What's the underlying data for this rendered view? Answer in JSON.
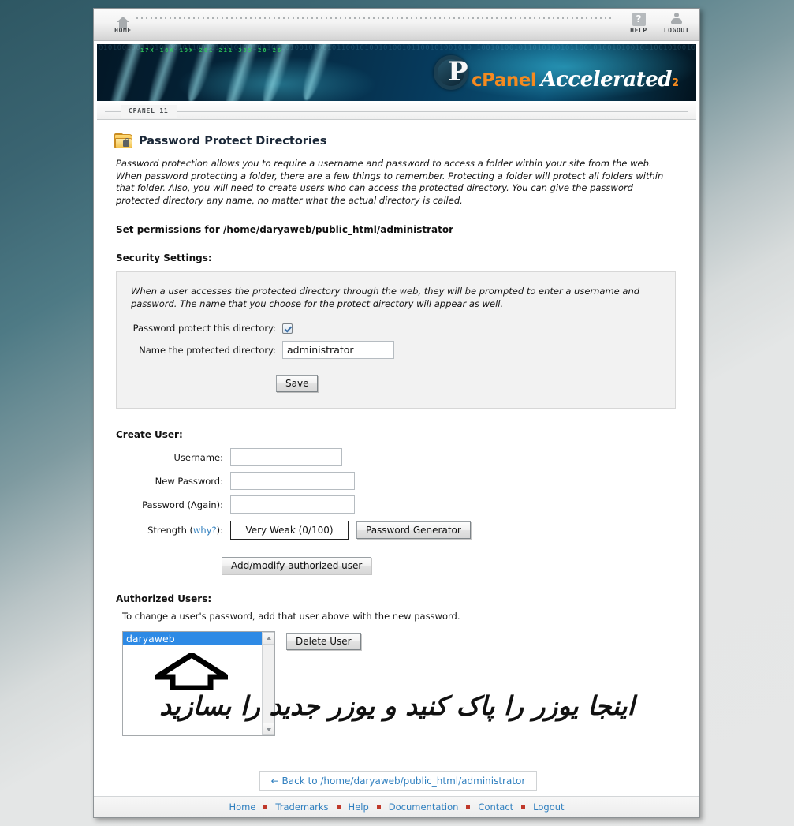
{
  "window": {
    "topbar": {
      "home": {
        "label": "HOME",
        "icon": "home-icon"
      },
      "help": {
        "label": "HELP",
        "icon": "question-mark-icon"
      },
      "logout": {
        "label": "LOGOUT",
        "icon": "person-icon"
      }
    },
    "banner": {
      "logo_main": "cPanel",
      "logo_accent": "Accelerated",
      "logo_sub": "2",
      "ticker": "17X    18X    19X    261   211   305   20   26",
      "binary": "01010010011010100101100101001010010110010100101001011001010010100101100101001010 10010100101101010010110010100101001011001010010100101100101001010010110010100101 01010010011010100101100101001010010110010100101001011001010010100101100101001010 10010100101101010010110010100101001011001010010100101100101001010010110010100101 01010010011010100101100101001010010110010100101001011001010010100101100101001010 10010100101101010010110010100101001011001010010100101100101001010010110010100101 01010010011010100101100101001010010110010100101001011001010010100101100101001010 10010100101101010010110010100101001011001010010100101100101001010010110010100101"
    },
    "tab": "CPANEL 11"
  },
  "page": {
    "title": "Password Protect Directories",
    "intro": "Password protection allows you to require a username and password to access a folder within your site from the web. When password protecting a folder, there are a few things to remember. Protecting a folder will protect all folders within that folder. Also, you will need to create users who can access the protected directory. You can give the password protected directory any name, no matter what the actual directory is called.",
    "permissions_line": "Set permissions for /home/daryaweb/public_html/administrator",
    "security_label": "Security Settings:"
  },
  "security": {
    "note": "When a user accesses the protected directory through the web, they will be prompted to enter a username and password. The name that you choose for the protect directory will appear as well.",
    "protect_label": "Password protect this directory:",
    "protect_checked": true,
    "name_label": "Name the protected directory:",
    "name_value": "administrator",
    "save_label": "Save"
  },
  "create_user": {
    "heading": "Create User:",
    "username_label": "Username:",
    "username_value": "",
    "new_password_label": "New Password:",
    "new_password_value": "",
    "password_again_label": "Password (Again):",
    "password_again_value": "",
    "strength_label": "Strength (",
    "strength_link": "why?",
    "strength_label_end": "):",
    "strength_value": "Very Weak (0/100)",
    "password_generator_label": "Password Generator",
    "add_modify_label": "Add/modify authorized user"
  },
  "authorized_users": {
    "heading": "Authorized Users:",
    "note": "To change a user's password, add that user above with the new password.",
    "users": [
      "daryaweb"
    ],
    "selected": "daryaweb",
    "delete_label": "Delete User"
  },
  "annotation": {
    "text": "اینجا یوزر را پاک کنید و یوزر جدید را بسازید",
    "arrow": "up-arrow-annotation"
  },
  "back": {
    "label": "← Back to /home/daryaweb/public_html/administrator"
  },
  "footer": {
    "links": [
      "Home",
      "Trademarks",
      "Help",
      "Documentation",
      "Contact",
      "Logout"
    ]
  },
  "colors": {
    "accent_blue": "#2f7fbf",
    "select_blue": "#2e8ae5",
    "brand_orange": "#f58a1f",
    "separator_red": "#c0392b"
  }
}
